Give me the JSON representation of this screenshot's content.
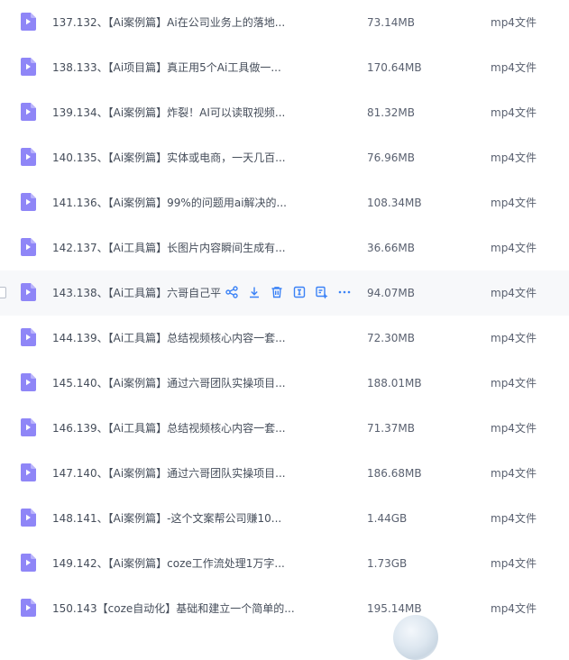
{
  "files": [
    {
      "name": "137.132、【Ai案例篇】Ai在公司业务上的落地...",
      "size": "73.14MB",
      "type": "mp4文件"
    },
    {
      "name": "138.133、【Ai项目篇】真正用5个Ai工具做一...",
      "size": "170.64MB",
      "type": "mp4文件"
    },
    {
      "name": "139.134、【Ai案例篇】炸裂！AI可以读取视频...",
      "size": "81.32MB",
      "type": "mp4文件"
    },
    {
      "name": "140.135、【Ai案例篇】实体或电商，一天几百...",
      "size": "76.96MB",
      "type": "mp4文件"
    },
    {
      "name": "141.136、【Ai案例篇】99%的问题用ai解决的...",
      "size": "108.34MB",
      "type": "mp4文件"
    },
    {
      "name": "142.137、【Ai工具篇】长图片内容瞬间生成有...",
      "size": "36.66MB",
      "type": "mp4文件"
    },
    {
      "name": "143.138、【Ai工具篇】六哥自己平",
      "size": "94.07MB",
      "type": "mp4文件"
    },
    {
      "name": "144.139、【Ai工具篇】总结视频核心内容一套...",
      "size": "72.30MB",
      "type": "mp4文件"
    },
    {
      "name": "145.140、【Ai案例篇】通过六哥团队实操项目...",
      "size": "188.01MB",
      "type": "mp4文件"
    },
    {
      "name": "146.139、【Ai工具篇】总结视频核心内容一套...",
      "size": "71.37MB",
      "type": "mp4文件"
    },
    {
      "name": "147.140、【Ai案例篇】通过六哥团队实操项目...",
      "size": "186.68MB",
      "type": "mp4文件"
    },
    {
      "name": "148.141、【Ai案例篇】-这个文案帮公司赚10...",
      "size": "1.44GB",
      "type": "mp4文件"
    },
    {
      "name": "149.142、【Ai案例篇】coze工作流处理1万字...",
      "size": "1.73GB",
      "type": "mp4文件"
    },
    {
      "name": "150.143【coze自动化】基础和建立一个简单的...",
      "size": "195.14MB",
      "type": "mp4文件"
    }
  ],
  "hover_row_index": 6,
  "hover_actions": [
    "share-icon",
    "download-icon",
    "delete-icon",
    "rename-icon",
    "ai-assistant-icon",
    "more-icon"
  ],
  "colors": {
    "icon_bg": "#8f86f7",
    "action_icon": "#3b82f6",
    "hover_bg": "#f7f8fa"
  }
}
